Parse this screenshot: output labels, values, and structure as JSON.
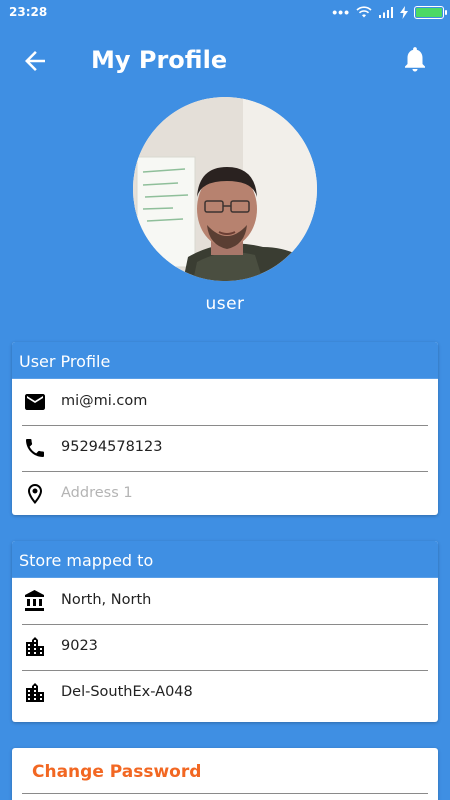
{
  "status_bar": {
    "time": "23:28",
    "icons": [
      "more-dots-icon",
      "wifi-icon",
      "signal-icon",
      "charging-icon",
      "battery-icon"
    ],
    "battery_color": "#4cd964"
  },
  "app_bar": {
    "title": "My Profile",
    "back_icon": "arrow-left-icon",
    "notification_icon": "bell-icon"
  },
  "profile": {
    "name": "user"
  },
  "user_profile_card": {
    "header": "User Profile",
    "email": "mi@mi.com",
    "phone": "95294578123",
    "address_placeholder": "Address 1"
  },
  "store_card": {
    "header": "Store mapped to",
    "region": "North, North",
    "store_code": "9023",
    "store_name": "Del-SouthEx-A048"
  },
  "change_password": {
    "label": "Change Password",
    "color": "#f26722"
  },
  "theme": {
    "primary": "#3f8fe3"
  }
}
